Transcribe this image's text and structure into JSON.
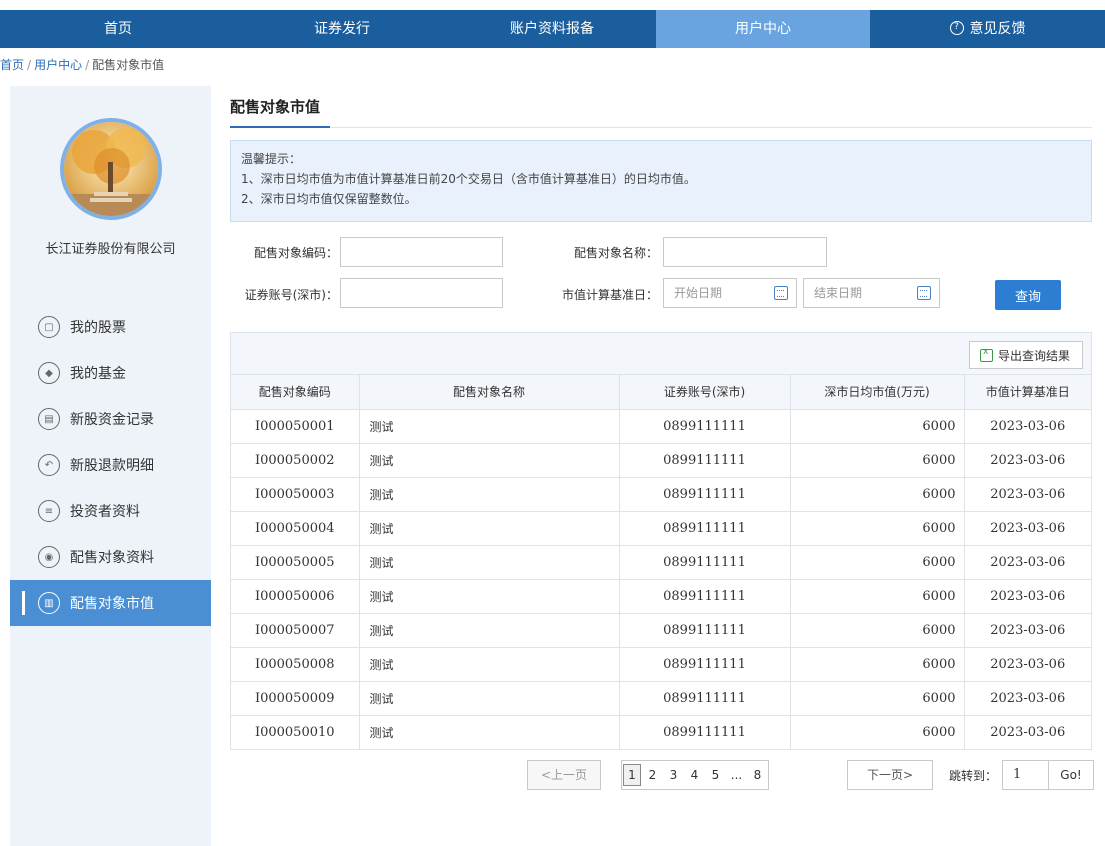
{
  "nav": {
    "items": [
      {
        "label": "首页"
      },
      {
        "label": "证券发行"
      },
      {
        "label": "账户资料报备"
      },
      {
        "label": "用户中心"
      },
      {
        "label": "意见反馈"
      }
    ],
    "active_index": 3,
    "feedback_icon": "question-circle-icon"
  },
  "breadcrumb": {
    "home": "首页",
    "sep": "/",
    "user_center": "用户中心",
    "current": "配售对象市值"
  },
  "sidebar": {
    "company": "长江证券股份有限公司",
    "menu": [
      {
        "label": "我的股票",
        "icon": "stock-chart-icon",
        "glyph": "▢"
      },
      {
        "label": "我的基金",
        "icon": "fund-icon",
        "glyph": "◆"
      },
      {
        "label": "新股资金记录",
        "icon": "money-record-icon",
        "glyph": "▤"
      },
      {
        "label": "新股退款明细",
        "icon": "refund-icon",
        "glyph": "↶"
      },
      {
        "label": "投资者资料",
        "icon": "list-icon",
        "glyph": "≡"
      },
      {
        "label": "配售对象资料",
        "icon": "target-icon",
        "glyph": "◉"
      },
      {
        "label": "配售对象市值",
        "icon": "bar-chart-icon",
        "glyph": "▥"
      }
    ],
    "active_index": 6
  },
  "page": {
    "title": "配售对象市值",
    "tip_title": "温馨提示：",
    "tip_1": "1、深市日均市值为市值计算基准日前20个交易日（含市值计算基准日）的日均市值。",
    "tip_2": "2、深市日均市值仅保留整数位。"
  },
  "form": {
    "code_label": "配售对象编码：",
    "code_value": "",
    "name_label": "配售对象名称：",
    "name_value": "",
    "account_label": "证券账号(深市)：",
    "account_value": "",
    "date_label": "市值计算基准日：",
    "start_placeholder": "开始日期",
    "end_placeholder": "结束日期",
    "query_button": "查询"
  },
  "table": {
    "export_button": "导出查询结果",
    "columns": [
      "配售对象编码",
      "配售对象名称",
      "证券账号(深市)",
      "深市日均市值(万元)",
      "市值计算基准日"
    ],
    "rows": [
      [
        "I000050001",
        "测试",
        "0899111111",
        "6000",
        "2023-03-06"
      ],
      [
        "I000050002",
        "测试",
        "0899111111",
        "6000",
        "2023-03-06"
      ],
      [
        "I000050003",
        "测试",
        "0899111111",
        "6000",
        "2023-03-06"
      ],
      [
        "I000050004",
        "测试",
        "0899111111",
        "6000",
        "2023-03-06"
      ],
      [
        "I000050005",
        "测试",
        "0899111111",
        "6000",
        "2023-03-06"
      ],
      [
        "I000050006",
        "测试",
        "0899111111",
        "6000",
        "2023-03-06"
      ],
      [
        "I000050007",
        "测试",
        "0899111111",
        "6000",
        "2023-03-06"
      ],
      [
        "I000050008",
        "测试",
        "0899111111",
        "6000",
        "2023-03-06"
      ],
      [
        "I000050009",
        "测试",
        "0899111111",
        "6000",
        "2023-03-06"
      ],
      [
        "I000050010",
        "测试",
        "0899111111",
        "6000",
        "2023-03-06"
      ]
    ]
  },
  "pager": {
    "prev": "<上一页",
    "pages": [
      "1",
      "2",
      "3",
      "4",
      "5",
      "...",
      "8"
    ],
    "current_page": "1",
    "next": "下一页>",
    "jump_label": "跳转到：",
    "jump_value": "1",
    "go": "Go!"
  },
  "colors": {
    "nav_bg": "#1b5e9e",
    "nav_active": "#6aa4e0",
    "sidebar_bg": "#eef3f9",
    "sidebar_active": "#4a8fd4",
    "primary_button": "#2d7dd2"
  }
}
